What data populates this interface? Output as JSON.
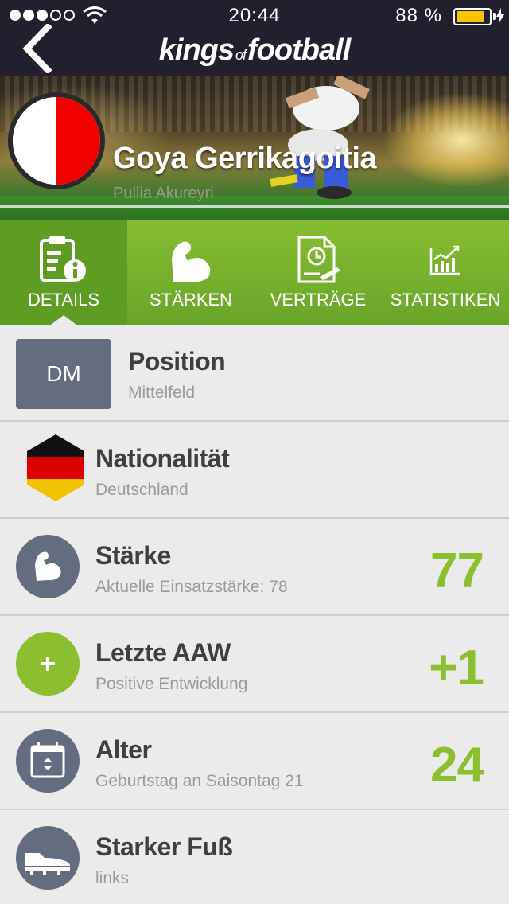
{
  "status_bar": {
    "time": "20:44",
    "battery_pct": "88 %",
    "battery_level": 0.88,
    "signal_bars": 3,
    "signal_total": 5
  },
  "nav": {
    "logo_main1": "kings",
    "logo_of": "of",
    "logo_main2": "football"
  },
  "hero": {
    "player_name": "Goya Gerrikagoitia",
    "club_name": "Pullia Akureyri",
    "club_colors": [
      "#ffffff",
      "#f40000"
    ]
  },
  "tabs": [
    {
      "label": "DETAILS",
      "icon": "details-icon",
      "active": true
    },
    {
      "label": "STÄRKEN",
      "icon": "muscle-icon",
      "active": false
    },
    {
      "label": "VERTRÄGE",
      "icon": "contract-icon",
      "active": false
    },
    {
      "label": "STATISTIKEN",
      "icon": "stats-icon",
      "active": false
    }
  ],
  "rows": {
    "position": {
      "badge": "DM",
      "title": "Position",
      "sub": "Mittelfeld"
    },
    "nationality": {
      "title": "Nationalität",
      "sub": "Deutschland",
      "flag_colors": [
        "#111111",
        "#dd0000",
        "#f2c300"
      ]
    },
    "strength": {
      "title": "Stärke",
      "sub": "Aktuelle Einsatzstärke: 78",
      "value": "77",
      "icon": "muscle-icon"
    },
    "last_aaw": {
      "title": "Letzte AAW",
      "sub": "Positive Entwicklung",
      "value": "+1",
      "icon": "plus-icon"
    },
    "age": {
      "title": "Alter",
      "sub": "Geburtstag an Saisontag 21",
      "value": "24",
      "icon": "calendar-icon"
    },
    "foot": {
      "title": "Starker Fuß",
      "sub": "links",
      "icon": "boot-icon"
    }
  },
  "colors": {
    "accent_green": "#8cbf2f",
    "dark_bar": "#22202e",
    "slate": "#646c80"
  }
}
